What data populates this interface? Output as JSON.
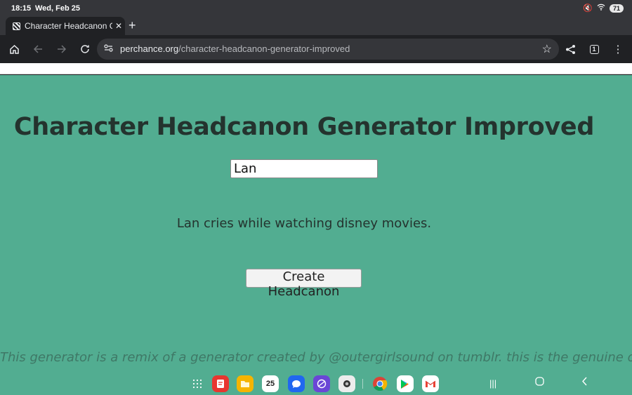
{
  "status": {
    "time": "18:15",
    "date": "Wed, Feb 25",
    "battery": "71"
  },
  "browser": {
    "tab_title": "Character Headcanon Generator Improved",
    "close_glyph": "✕",
    "new_tab_glyph": "+",
    "url_domain": "perchance.org",
    "url_path": "/character-headcanon-generator-improved",
    "tab_count": "1"
  },
  "page": {
    "heading": "Character Headcanon Generator Improved",
    "name_value": "Lan",
    "result_text": "Lan cries while watching disney movies.",
    "button_label": "Create Headcanon",
    "footer_text": "This generator is a remix of a generator created by @outergirlsound on tumblr. this is the genuine one"
  },
  "taskbar": {
    "calendar_day": "25",
    "apps": [
      "app-drawer",
      "notes",
      "my-files",
      "calendar",
      "messages",
      "internet",
      "camera",
      "chrome",
      "play-store",
      "gmail"
    ]
  },
  "colors": {
    "page_bg": "#52ad91",
    "heading": "#24332e",
    "footer": "#3f7866",
    "chrome_dark": "#202124"
  }
}
